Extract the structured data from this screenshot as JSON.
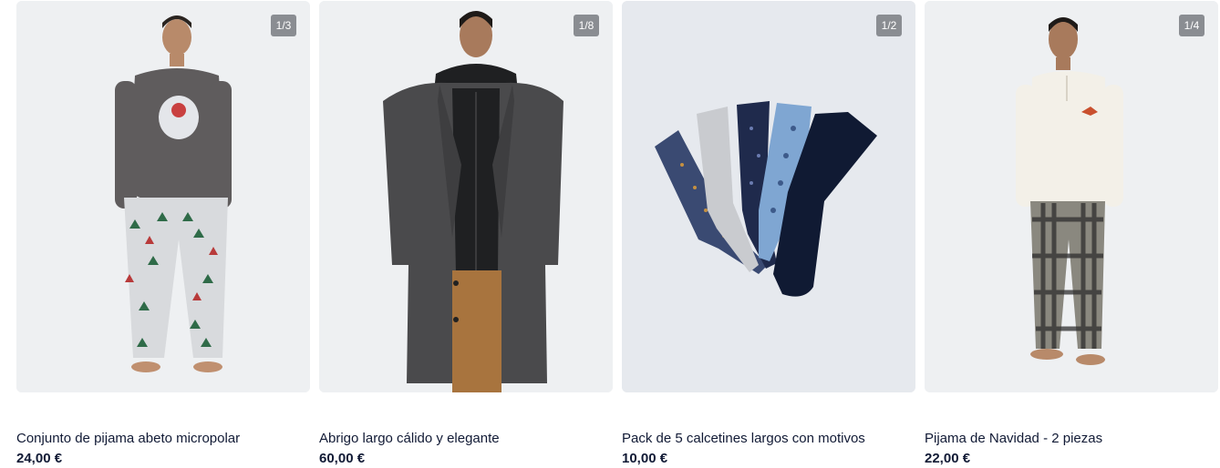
{
  "products": [
    {
      "image_counter": "1/3",
      "title": "Conjunto de pijama abeto micropolar",
      "price": "24,00 €"
    },
    {
      "image_counter": "1/8",
      "title": "Abrigo largo cálido y elegante",
      "price": "60,00 €"
    },
    {
      "image_counter": "1/2",
      "title": "Pack de 5 calcetines largos con motivos",
      "price": "10,00 €"
    },
    {
      "image_counter": "1/4",
      "title": "Pijama de Navidad - 2 piezas",
      "price": "22,00 €"
    }
  ],
  "colors": {
    "text": "#111a35",
    "badge_bg": "#8a8d92",
    "image_bg": "#eceef1"
  }
}
